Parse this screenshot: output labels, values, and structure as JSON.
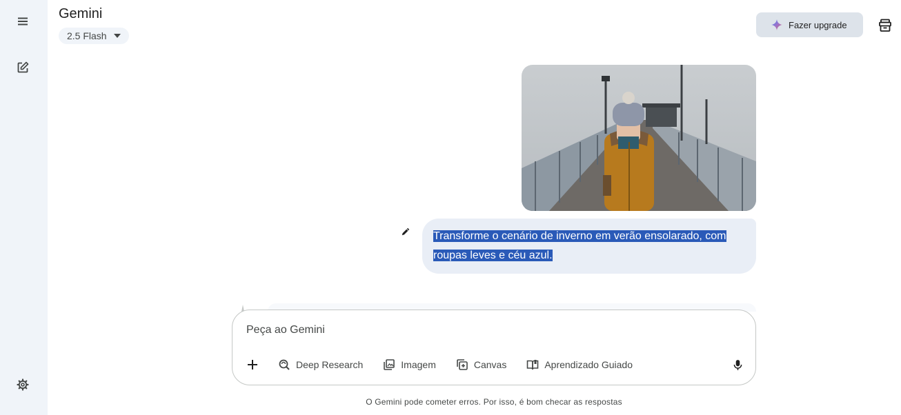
{
  "app": {
    "title": "Gemini"
  },
  "model_selector": {
    "label": "2.5 Flash"
  },
  "header": {
    "upgrade_label": "Fazer upgrade"
  },
  "chat": {
    "user_message": "Transforme o cenário de inverno em verão ensolarado, com roupas leves e céu azul."
  },
  "input": {
    "placeholder": "Peça ao Gemini",
    "value": "",
    "tools": [
      {
        "label": "Deep Research",
        "icon": "deep-research-icon"
      },
      {
        "label": "Imagem",
        "icon": "image-gallery-icon"
      },
      {
        "label": "Canvas",
        "icon": "canvas-icon"
      },
      {
        "label": "Aprendizado Guiado",
        "icon": "guided-learning-icon"
      }
    ]
  },
  "footer": {
    "disclaimer": "O Gemini pode cometer erros. Por isso, é bom checar as respostas"
  },
  "colors": {
    "rail_bg": "#f0f4f9",
    "bubble_bg": "#e9eef6",
    "selection": "#2a5ab8",
    "upgrade_bg": "#dde3ea"
  }
}
